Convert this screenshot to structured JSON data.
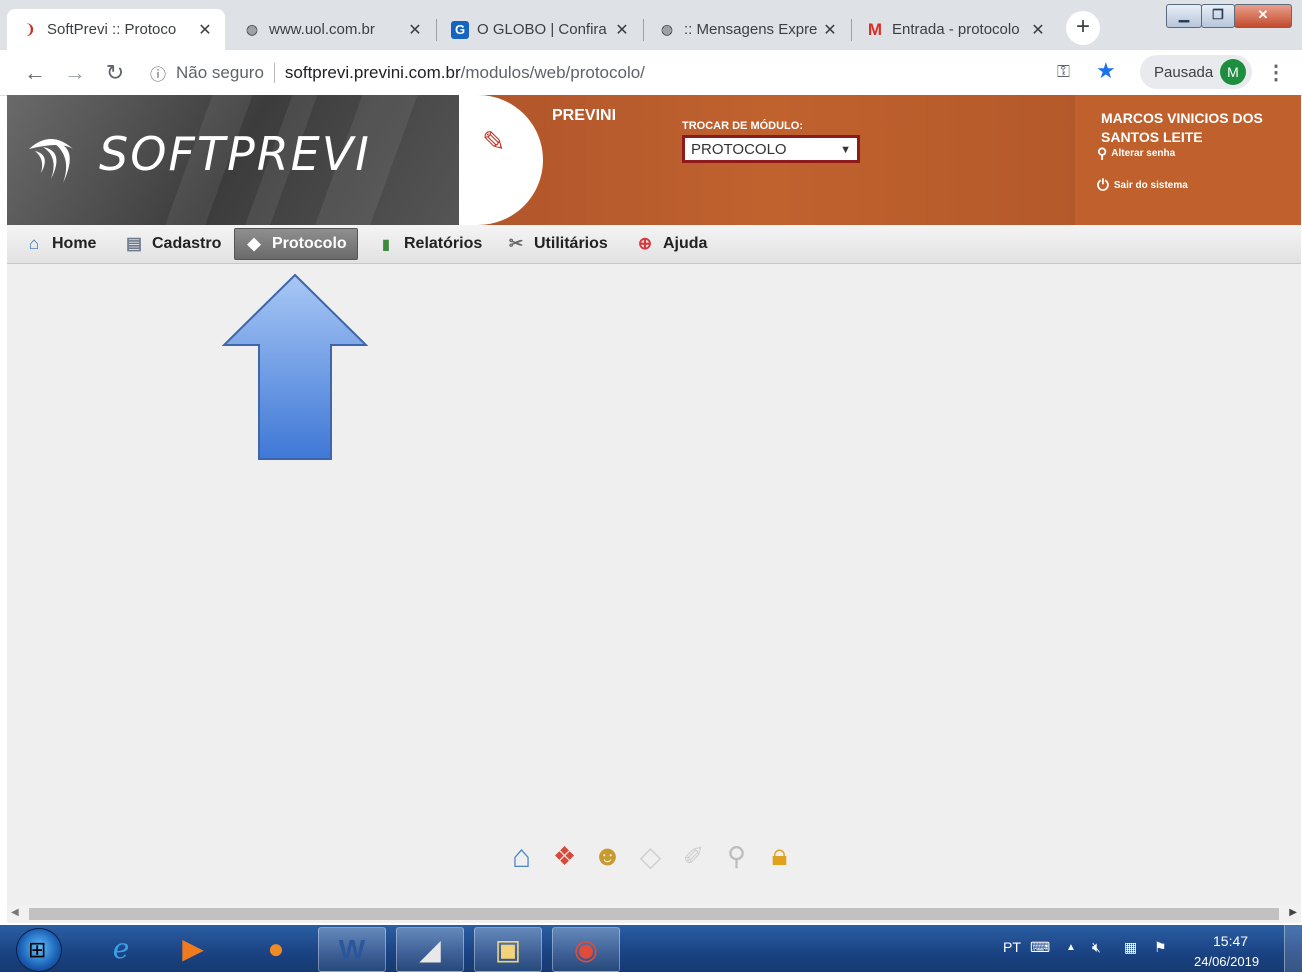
{
  "browser": {
    "tabs": [
      {
        "title": "SoftPrevi :: Protoco",
        "favicon": "softprevi-favicon",
        "active": true
      },
      {
        "title": "www.uol.com.br",
        "favicon": "globe-icon",
        "active": false
      },
      {
        "title": "O GLOBO | Confira",
        "favicon": "g-favicon",
        "active": false
      },
      {
        "title": ":: Mensagens Expre",
        "favicon": "globe-icon",
        "active": false
      },
      {
        "title": "Entrada - protocolo",
        "favicon": "gmail-icon",
        "active": false
      }
    ],
    "security_label": "Não seguro",
    "url_host": "softprevi.previni.com.br",
    "url_path": "/modulos/web/protocolo/",
    "profile_status": "Pausada",
    "profile_initial": "M"
  },
  "app": {
    "logo_text": "SOFTPREVI",
    "org_name": "PREVINI",
    "module_label": "TROCAR DE MÓDULO:",
    "module_selected": "PROTOCOLO",
    "user_name_line1": "MARCOS VINICIOS DOS",
    "user_name_line2": "SANTOS LEITE",
    "change_password": "Alterar senha",
    "logout": "Sair do sistema",
    "colors": {
      "brand_orange": "#c0612d",
      "select_border": "#8e1b1b",
      "arrow_blue": "#5b8fe0"
    }
  },
  "menu": {
    "items": [
      {
        "label": "Home",
        "icon": "house-icon"
      },
      {
        "label": "Cadastro",
        "icon": "document-icon"
      },
      {
        "label": "Protocolo",
        "icon": "protocol-icon",
        "active": true
      },
      {
        "label": "Relatórios",
        "icon": "bar-chart-icon"
      },
      {
        "label": "Utilitários",
        "icon": "tools-icon"
      },
      {
        "label": "Ajuda",
        "icon": "lifebuoy-icon"
      }
    ]
  },
  "dock": {
    "icons": [
      "house-icon",
      "cubes-icon",
      "users-icon",
      "layers-icon",
      "pencil-icon",
      "magnifier-icon",
      "padlock-icon"
    ]
  },
  "taskbar": {
    "apps": [
      "internet-explorer-icon",
      "media-player-icon",
      "firefox-icon",
      "word-icon",
      "softprevi-app-icon",
      "file-explorer-icon",
      "chrome-icon"
    ],
    "language": "PT",
    "time": "15:47",
    "date": "24/06/2019"
  }
}
